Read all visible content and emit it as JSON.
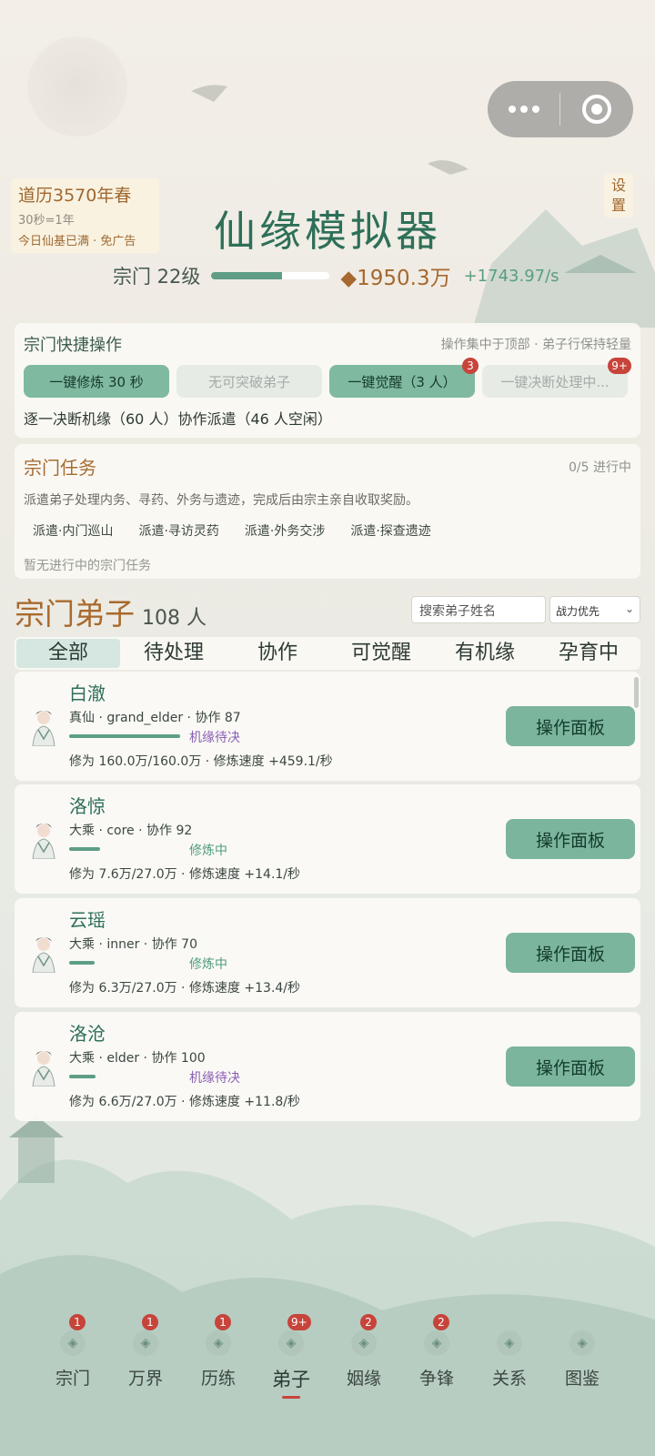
{
  "capsule": {
    "more_icon": "more-dots-icon",
    "close_icon": "target-icon"
  },
  "calendar": {
    "year": "道历3570年春",
    "rate": "30秒=1年",
    "note": "今日仙基已满 · 免广告"
  },
  "settings_label": "设\n置",
  "title": "仙缘模拟器",
  "sect": {
    "level": "宗门 22级",
    "level_progress": 0.6,
    "money": "◆1950.3万",
    "money_rate": "+1743.97/s"
  },
  "quick": {
    "title": "宗门快捷操作",
    "hint": "操作集中于顶部 · 弟子行保持轻量",
    "buttons": [
      {
        "label": "一键修炼 30 秒",
        "state": "on",
        "badge": ""
      },
      {
        "label": "无可突破弟子",
        "state": "off",
        "badge": ""
      },
      {
        "label": "一键觉醒（3 人）",
        "state": "on",
        "badge": "3"
      },
      {
        "label": "一键决断处理中...",
        "state": "off",
        "badge": "9+"
      }
    ],
    "note": "逐一决断机缘（60 人）协作派遣（46 人空闲）"
  },
  "task": {
    "title": "宗门任务",
    "progress": "0/5 进行中",
    "desc": "派遣弟子处理内务、寻药、外务与遗迹，完成后由宗主亲自收取奖励。",
    "actions": [
      "派遣·内门巡山",
      "派遣·寻访灵药",
      "派遣·外务交涉",
      "派遣·探查遗迹"
    ],
    "empty": "暂无进行中的宗门任务"
  },
  "disciples": {
    "title": "宗门弟子",
    "count": "108 人",
    "search_placeholder": "搜索弟子姓名",
    "sort": "战力优先",
    "tabs": [
      "全部",
      "待处理",
      "协作",
      "可觉醒",
      "有机缘",
      "孕育中"
    ],
    "active_tab": 0,
    "op_label": "操作面板",
    "list": [
      {
        "name": "白澈",
        "meta": "真仙 · grand_elder · 协作 87",
        "progress": 1.0,
        "status": "机缘待决",
        "status_color": "#8a5fb5",
        "power": "修为 160.0万/160.0万 · 修炼速度 +459.1/秒"
      },
      {
        "name": "洛惊",
        "meta": "大乘 · core · 协作 92",
        "progress": 0.28,
        "status": "修炼中",
        "status_color": "#4f9c7c",
        "power": "修为 7.6万/27.0万 · 修炼速度 +14.1/秒"
      },
      {
        "name": "云瑶",
        "meta": "大乘 · inner · 协作 70",
        "progress": 0.23,
        "status": "修炼中",
        "status_color": "#4f9c7c",
        "power": "修为 6.3万/27.0万 · 修炼速度 +13.4/秒"
      },
      {
        "name": "洛沧",
        "meta": "大乘 · elder · 协作 100",
        "progress": 0.24,
        "status": "机缘待决",
        "status_color": "#8a5fb5",
        "power": "修为 6.6万/27.0万 · 修炼速度 +11.8/秒"
      }
    ]
  },
  "nav": [
    {
      "label": "宗门",
      "badge": "1",
      "icon": "sect-icon"
    },
    {
      "label": "万界",
      "badge": "1",
      "icon": "realm-icon"
    },
    {
      "label": "历练",
      "badge": "1",
      "icon": "trial-icon"
    },
    {
      "label": "弟子",
      "badge": "9+",
      "icon": "disciple-icon",
      "active": true
    },
    {
      "label": "姻缘",
      "badge": "2",
      "icon": "bond-icon"
    },
    {
      "label": "争锋",
      "badge": "2",
      "icon": "battle-icon"
    },
    {
      "label": "关系",
      "badge": "",
      "icon": "relation-icon"
    },
    {
      "label": "图鉴",
      "badge": "",
      "icon": "codex-icon"
    }
  ]
}
